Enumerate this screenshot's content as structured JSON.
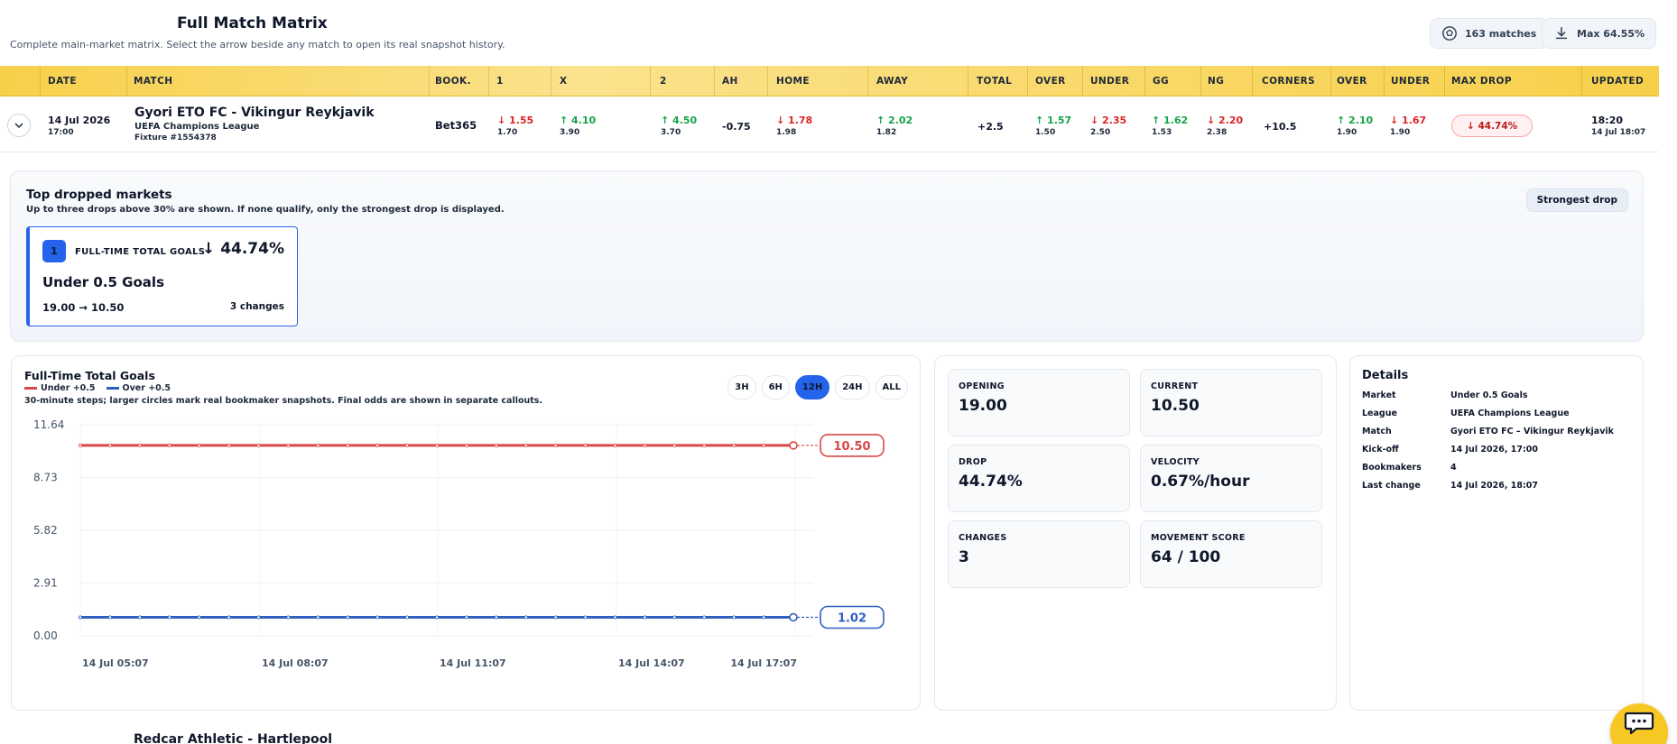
{
  "header": {
    "title": "Full Match Matrix",
    "subtitle": "Complete main-market matrix. Select the arrow beside any match to open its real snapshot history.",
    "matches_label": "163 matches",
    "max_label": "Max 64.55%"
  },
  "columns": [
    "DATE",
    "MATCH",
    "BOOK.",
    "1",
    "X",
    "2",
    "AH",
    "HOME",
    "AWAY",
    "TOTAL",
    "OVER",
    "UNDER",
    "GG",
    "NG",
    "CORNERS",
    "OVER",
    "UNDER",
    "MAX DROP",
    "UPDATED"
  ],
  "row": {
    "date": "14 Jul 2026",
    "time": "17:00",
    "match": "Gyori ETO FC - Vikingur Reykjavik",
    "league": "UEFA Champions League",
    "fixture": "Fixture #1554378",
    "bookmaker": "Bet365",
    "odds": [
      {
        "current": "↓ 1.55",
        "opening": "1.70",
        "dir": "down"
      },
      {
        "current": "↑ 4.10",
        "opening": "3.90",
        "dir": "up"
      },
      {
        "current": "↑ 4.50",
        "opening": "3.70",
        "dir": "up"
      }
    ],
    "ah": "-0.75",
    "home": {
      "current": "↓ 1.78",
      "opening": "1.98",
      "dir": "down"
    },
    "away": {
      "current": "↑ 2.02",
      "opening": "1.82",
      "dir": "up"
    },
    "total": "+2.5",
    "over": {
      "current": "↑ 1.57",
      "opening": "1.50",
      "dir": "up"
    },
    "under": {
      "current": "↓ 2.35",
      "opening": "2.50",
      "dir": "down"
    },
    "gg": {
      "current": "↑ 1.62",
      "opening": "1.53",
      "dir": "up"
    },
    "ng": {
      "current": "↓ 2.20",
      "opening": "2.38",
      "dir": "down"
    },
    "corners": "+10.5",
    "c_over": {
      "current": "↑ 2.10",
      "opening": "1.90",
      "dir": "up"
    },
    "c_under": {
      "current": "↓ 1.67",
      "opening": "1.90",
      "dir": "down"
    },
    "max_drop": "↓ 44.74%",
    "updated_time": "18:20",
    "updated_date": "14 Jul 18:07"
  },
  "drops": {
    "title": "Top dropped markets",
    "subtitle": "Up to three drops above 30% are shown. If none qualify, only the strongest drop is displayed.",
    "strongest_label": "Strongest drop",
    "card": {
      "rank": "1",
      "market": "FULL-TIME TOTAL GOALS",
      "pct": "↓ 44.74%",
      "selection": "Under 0.5 Goals",
      "range": "19.00 → 10.50",
      "changes": "3 changes"
    }
  },
  "chart_panel": {
    "title": "Full-Time Total Goals",
    "note": "30-minute steps; larger circles mark real bookmaker snapshots. Final odds are shown in separate callouts.",
    "ranges": [
      "3H",
      "6H",
      "12H",
      "24H",
      "ALL"
    ],
    "active_range": "12H"
  },
  "chart_data": {
    "type": "line",
    "title": "Full-Time Total Goals",
    "x_ticks": [
      "14 Jul 05:07",
      "14 Jul 08:07",
      "14 Jul 11:07",
      "14 Jul 14:07",
      "14 Jul 17:07"
    ],
    "y_ticks": [
      "0.00",
      "2.91",
      "5.82",
      "8.73",
      "11.64"
    ],
    "ylim": [
      0,
      11.64
    ],
    "step_count": 24,
    "series": [
      {
        "name": "Under +0.5",
        "color": "#d94848",
        "value": 10.5,
        "final_label": "10.50"
      },
      {
        "name": "Over +0.5",
        "color": "#2f5fbf",
        "value": 1.02,
        "final_label": "1.02"
      }
    ],
    "grid": true,
    "legend": "top-left"
  },
  "stats": [
    {
      "label": "OPENING",
      "value": "19.00"
    },
    {
      "label": "CURRENT",
      "value": "10.50"
    },
    {
      "label": "DROP",
      "value": "44.74%"
    },
    {
      "label": "VELOCITY",
      "value": "0.67%/hour"
    },
    {
      "label": "CHANGES",
      "value": "3"
    },
    {
      "label": "MOVEMENT SCORE",
      "value": "64 / 100"
    }
  ],
  "details": {
    "title": "Details",
    "rows": [
      {
        "k": "Market",
        "v": "Under 0.5 Goals"
      },
      {
        "k": "League",
        "v": "UEFA Champions League"
      },
      {
        "k": "Match",
        "v": "Gyori ETO FC – Vikingur Reykjavik"
      },
      {
        "k": "Kick-off",
        "v": "14 Jul 2026, 17:00"
      },
      {
        "k": "Bookmakers",
        "v": "4"
      },
      {
        "k": "Last change",
        "v": "14 Jul 2026, 18:07"
      }
    ]
  },
  "next_row": {
    "match": "Redcar Athletic - Hartlepool"
  }
}
